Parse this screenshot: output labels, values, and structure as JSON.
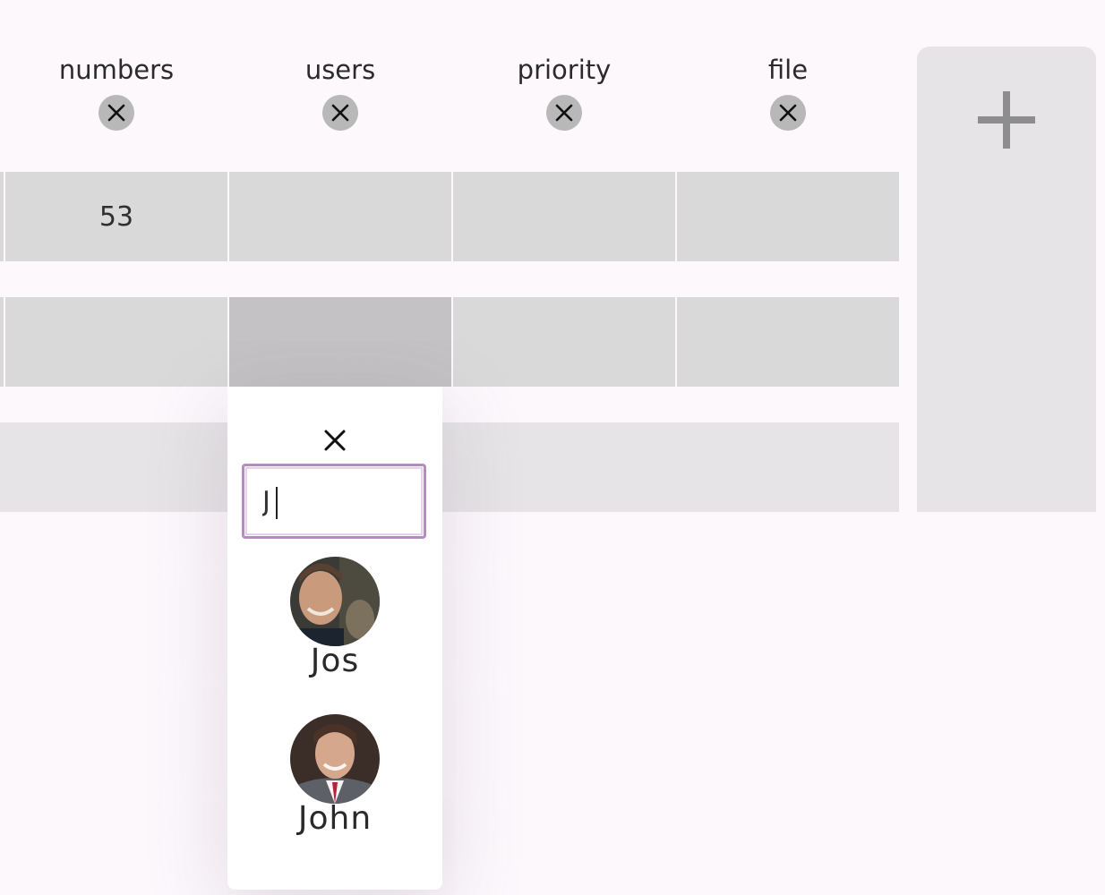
{
  "columns": [
    {
      "title": "numbers"
    },
    {
      "title": "users"
    },
    {
      "title": "priority"
    },
    {
      "title": "file"
    }
  ],
  "rows": [
    {
      "cells": [
        "53",
        "",
        "",
        ""
      ]
    },
    {
      "cells": [
        "",
        "",
        "",
        ""
      ]
    }
  ],
  "add_column": {
    "icon": "plus-icon"
  },
  "user_picker": {
    "close_icon": "close-icon",
    "search_value": "J",
    "options": [
      {
        "name": "Jos"
      },
      {
        "name": "John"
      }
    ]
  },
  "colors": {
    "background": "#fcf8fc",
    "cell": "#d9d9d9",
    "active_cell": "#c4c2c4",
    "input_focus_border": "#b58cc0"
  }
}
